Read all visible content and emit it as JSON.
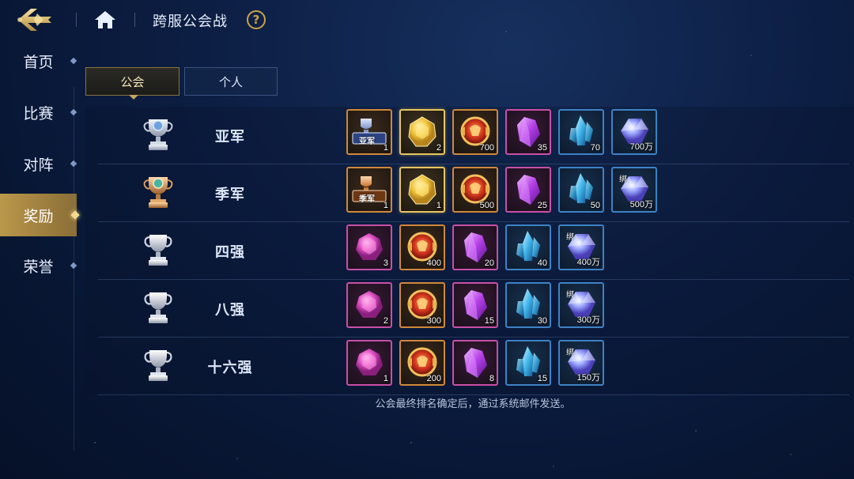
{
  "header": {
    "back_icon": "back-arrow-icon",
    "home_icon": "home-icon",
    "title": "跨服公会战",
    "help_label": "?"
  },
  "sidebar": {
    "items": [
      {
        "label": "首页"
      },
      {
        "label": "比赛"
      },
      {
        "label": "对阵"
      },
      {
        "label": "奖励",
        "active": true
      },
      {
        "label": "荣誉"
      }
    ]
  },
  "tabs": [
    {
      "label": "公会",
      "active": true
    },
    {
      "label": "个人"
    }
  ],
  "rows": [
    {
      "rank": "亚军",
      "trophy": "silver-trophy-icon",
      "rewards": [
        {
          "icon": "runner-up-badge-icon",
          "frame": "orange",
          "count": "1",
          "banner": "亚军"
        },
        {
          "icon": "yellow-gem-icon",
          "frame": "gold",
          "count": "2"
        },
        {
          "icon": "red-medal-icon",
          "frame": "orange",
          "count": "700"
        },
        {
          "icon": "purple-crystal-icon",
          "frame": "pink",
          "count": "35"
        },
        {
          "icon": "blue-crystal-icon",
          "frame": "blue",
          "count": "70"
        },
        {
          "icon": "diamond-icon",
          "frame": "blue",
          "count": "700万"
        }
      ]
    },
    {
      "rank": "季军",
      "trophy": "bronze-trophy-icon",
      "rewards": [
        {
          "icon": "third-place-badge-icon",
          "frame": "orange",
          "count": "1",
          "banner": "季军"
        },
        {
          "icon": "yellow-gem-icon",
          "frame": "gold",
          "count": "1"
        },
        {
          "icon": "red-medal-icon",
          "frame": "orange",
          "count": "500"
        },
        {
          "icon": "purple-crystal-icon",
          "frame": "pink",
          "count": "25"
        },
        {
          "icon": "blue-crystal-icon",
          "frame": "blue",
          "count": "50"
        },
        {
          "icon": "diamond-icon",
          "frame": "blue",
          "count": "500万",
          "bind": "绑"
        }
      ]
    },
    {
      "rank": "四强",
      "trophy": "silver-cup-icon",
      "rewards": [
        {
          "icon": "pink-gem-icon",
          "frame": "pink",
          "count": "3"
        },
        {
          "icon": "red-medal-icon",
          "frame": "orange",
          "count": "400"
        },
        {
          "icon": "purple-crystal-icon",
          "frame": "pink",
          "count": "20"
        },
        {
          "icon": "blue-crystal-icon",
          "frame": "blue",
          "count": "40"
        },
        {
          "icon": "diamond-icon",
          "frame": "blue",
          "count": "400万",
          "bind": "绑"
        }
      ]
    },
    {
      "rank": "八强",
      "trophy": "silver-cup-icon",
      "rewards": [
        {
          "icon": "pink-gem-icon",
          "frame": "pink",
          "count": "2"
        },
        {
          "icon": "red-medal-icon",
          "frame": "orange",
          "count": "300"
        },
        {
          "icon": "purple-crystal-icon",
          "frame": "pink",
          "count": "15"
        },
        {
          "icon": "blue-crystal-icon",
          "frame": "blue",
          "count": "30"
        },
        {
          "icon": "diamond-icon",
          "frame": "blue",
          "count": "300万",
          "bind": "绑"
        }
      ]
    },
    {
      "rank": "十六强",
      "trophy": "silver-cup-icon",
      "rewards": [
        {
          "icon": "pink-gem-icon",
          "frame": "pink",
          "count": "1"
        },
        {
          "icon": "red-medal-icon",
          "frame": "orange",
          "count": "200"
        },
        {
          "icon": "purple-crystal-icon",
          "frame": "pink",
          "count": "8"
        },
        {
          "icon": "blue-crystal-icon",
          "frame": "blue",
          "count": "15"
        },
        {
          "icon": "diamond-icon",
          "frame": "blue",
          "count": "150万",
          "bind": "绑"
        }
      ]
    }
  ],
  "footer_note": "公会最终排名确定后，通过系统邮件发送。",
  "colors": {
    "accent_gold": "#c49e4c",
    "frame_orange": "#d0883a",
    "frame_gold": "#e8c560",
    "frame_pink": "#c94fa6",
    "frame_blue": "#3d82c6"
  }
}
